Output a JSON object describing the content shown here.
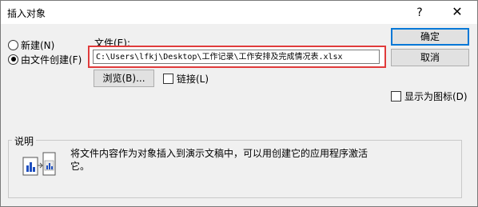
{
  "window": {
    "title": "插入对象",
    "help_glyph": "?",
    "close_glyph": "✕"
  },
  "source_options": {
    "new_label": "新建(N)",
    "from_file_label": "由文件创建(F)",
    "selected": "from_file"
  },
  "file": {
    "label": "文件(E):",
    "value": "C:\\Users\\lfkj\\Desktop\\工作记录\\工作安排及完成情况表.xlsx"
  },
  "buttons": {
    "ok": "确定",
    "cancel": "取消",
    "browse": "浏览(B)..."
  },
  "link": {
    "label": "链接(L)",
    "checked": false
  },
  "display_as_icon": {
    "label": "显示为图标(D)",
    "checked": false
  },
  "description": {
    "group_label": "说明",
    "text": "将文件内容作为对象插入到演示文稿中，可以用创建它的应用程序激活它。"
  }
}
